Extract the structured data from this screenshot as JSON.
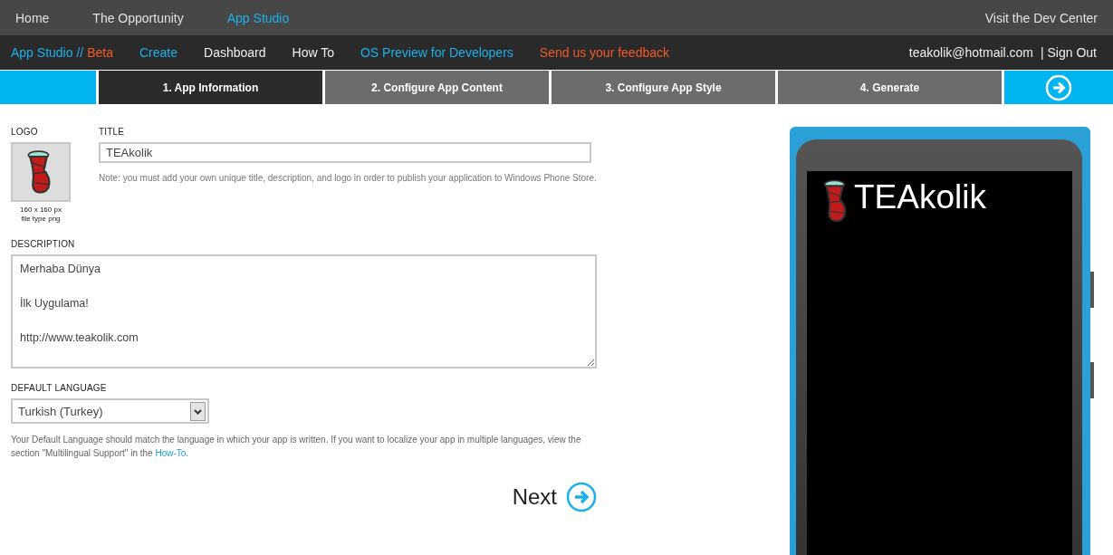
{
  "top_nav": {
    "items": [
      {
        "label": "Home",
        "selected": false
      },
      {
        "label": "The Opportunity",
        "selected": false
      },
      {
        "label": "App Studio",
        "selected": true
      }
    ],
    "right_link": "Visit the Dev Center"
  },
  "sub_nav": {
    "brand": "App Studio //",
    "brand_tag": "Beta",
    "items": [
      {
        "label": "Create",
        "color": "#1ab0ec"
      },
      {
        "label": "Dashboard",
        "color": "#eeeeee"
      },
      {
        "label": "How To",
        "color": "#eeeeee"
      },
      {
        "label": "OS Preview for Developers",
        "color": "#1ab0ec"
      },
      {
        "label": "Send us your feedback",
        "color": "#f05a28"
      }
    ],
    "user": "teakolik@hotmail.com",
    "sign_out": "| Sign Out"
  },
  "steps": [
    {
      "label": "1. App Information",
      "selected": true
    },
    {
      "label": "2. Configure App Content",
      "selected": false
    },
    {
      "label": "3. Configure App Style",
      "selected": false
    },
    {
      "label": "4. Generate",
      "selected": false
    }
  ],
  "form": {
    "logo": {
      "label": "LOGO",
      "size": "160 x 160 px",
      "file_type": "file type png"
    },
    "title": {
      "label": "TITLE",
      "value": "TEAkolik"
    },
    "note": "Note: you must add your own unique title, description, and logo in order to publish your application to Windows Phone Store.",
    "description": {
      "label": "DESCRIPTION",
      "value": "Merhaba Dünya\n\nİlk Uygulama!\n\nhttp://www.teakolik.com"
    },
    "default_language": {
      "label": "DEFAULT LANGUAGE",
      "value": "Turkish (Turkey)"
    },
    "help": {
      "text": "Your Default Language should match the language in which your app is written. If you want to localize your app in multiple languages, view the section \"Multilingual Support\" in the ",
      "link": "How-To",
      "end": "."
    },
    "next": "Next"
  },
  "phone_preview": {
    "title": "TEAkolik"
  }
}
